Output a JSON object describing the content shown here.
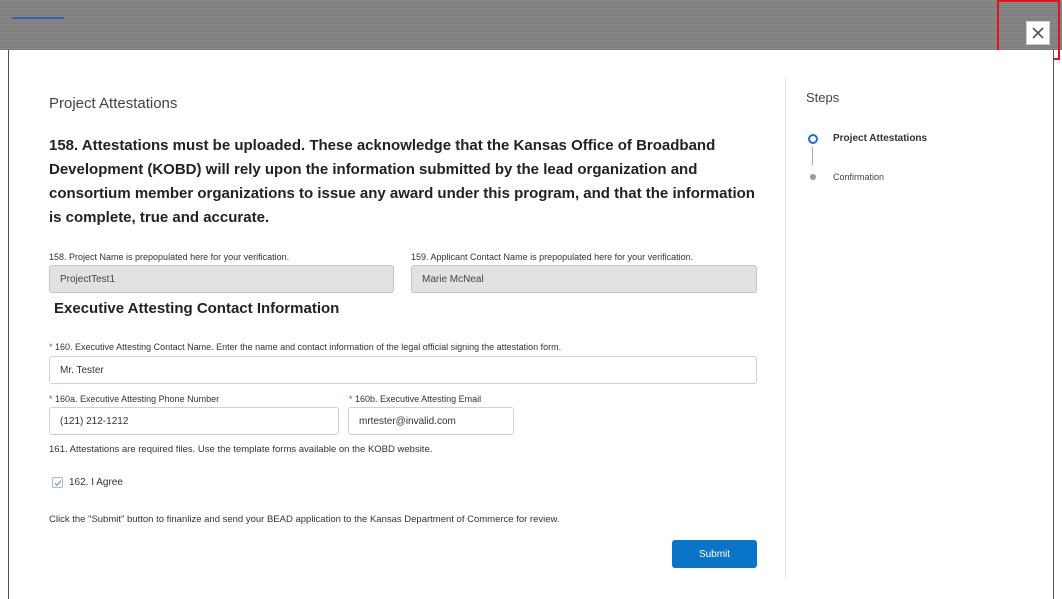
{
  "window": {
    "close_label": "×"
  },
  "form": {
    "panel_title": "Project Attestations",
    "question": "158. Attestations must be uploaded. These acknowledge that the Kansas Office of Broadband Development (KOBD) will rely upon the information submitted by the lead organization and consortium member organizations to issue any award under this program, and that the information is complete, true and accurate.",
    "project_name": {
      "label": "158. Project Name is prepopulated here for your verification.",
      "value": "ProjectTest1"
    },
    "applicant_contact": {
      "label": "159. Applicant Contact Name is prepopulated here for your verification.",
      "value": "Marie McNeal"
    },
    "section_heading": "Executive Attesting Contact Information",
    "exec_name": {
      "required_mark": "*",
      "label": "160. Executive Attesting Contact Name. Enter the name and contact information of the legal official signing the attestation form.",
      "value": "Mr. Tester"
    },
    "exec_phone": {
      "required_mark": "*",
      "label": "160a. Executive Attesting Phone Number",
      "value": "(121) 212-1212"
    },
    "exec_email": {
      "required_mark": "*",
      "label": "160b. Executive Attesting Email",
      "value": "mrtester@invalid.com"
    },
    "attestation_note": "161. Attestations are required files. Use the template forms available on the KOBD website.",
    "agree": {
      "label": "162. I Agree",
      "checked": true
    },
    "submit_note": "Click the \"Submit\" button to finanlize and send your BEAD application to the Kansas Department of Commerce for review.",
    "submit_label": "Submit"
  },
  "steps": {
    "title": "Steps",
    "items": [
      {
        "label": "Project Attestations",
        "state": "current"
      },
      {
        "label": "Confirmation",
        "state": "upcoming"
      }
    ]
  },
  "colors": {
    "accent": "#0a74c8",
    "step_active": "#1b6fd1",
    "highlight_box": "#e0141e",
    "required": "#c23934"
  }
}
